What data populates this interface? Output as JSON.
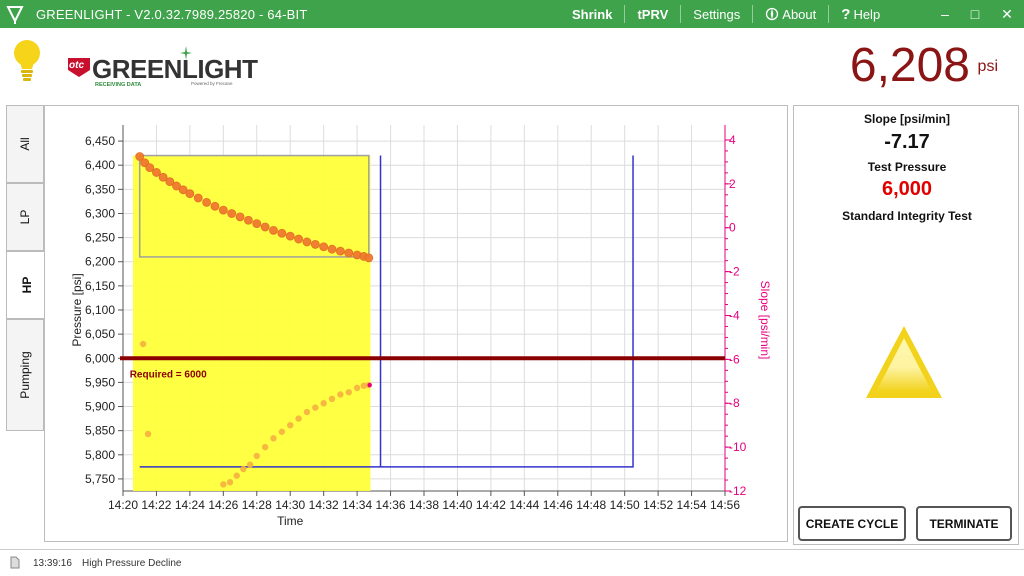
{
  "window": {
    "title": "GREENLIGHT - V2.0.32.7989.25820 - 64-BIT",
    "menu": {
      "shrink": "Shrink",
      "tprv": "tPRV",
      "settings": "Settings",
      "about": "About",
      "help": "Help"
    },
    "controls": {
      "minimize": "–",
      "maximize": "□",
      "close": "✕"
    }
  },
  "colors": {
    "titlebar": "#3ea34a",
    "pressure_red": "#8b1414",
    "required_line": "#8b0000",
    "highlight_fill": "#ffff33",
    "pressure_points": "#f07a2e",
    "slope_points": "#f5b041",
    "slope_axis": "#e6007e",
    "step_line": "#3333cc",
    "test_pressure": "#e00000",
    "triangle": "#f2d21a"
  },
  "brand": {
    "mark": "otc",
    "name": "GREENLIGHT",
    "status": "RECEIVING DATA",
    "powered": "Powered by Frecane",
    "bulb_icon": "lightbulb-icon"
  },
  "current_pressure": {
    "value": "6,208",
    "unit": "psi"
  },
  "tabs": [
    {
      "label": "All",
      "active": false
    },
    {
      "label": "LP",
      "active": false
    },
    {
      "label": "HP",
      "active": true
    },
    {
      "label": "Pumping",
      "active": false
    }
  ],
  "right_panel": {
    "slope_label": "Slope [psi/min]",
    "slope_value": "-7.17",
    "test_pressure_label": "Test Pressure",
    "test_pressure_value": "6,000",
    "test_name": "Standard Integrity Test",
    "status_icon": "warning-triangle-icon",
    "create_cycle_label": "CREATE CYCLE",
    "terminate_label": "TERMINATE"
  },
  "status_bar": {
    "icon": "document-icon",
    "time": "13:39:16",
    "message": "High Pressure Decline"
  },
  "chart_data": {
    "type": "scatter",
    "xlabel": "Time",
    "ylabel": "Pressure [psi]",
    "y2label": "Slope [psi/min]",
    "x_ticks": [
      "14:20",
      "14:22",
      "14:24",
      "14:26",
      "14:28",
      "14:30",
      "14:32",
      "14:34",
      "14:36",
      "14:38",
      "14:40",
      "14:42",
      "14:44",
      "14:46",
      "14:48",
      "14:50",
      "14:52",
      "14:54",
      "14:56"
    ],
    "x_range_minutes": [
      0,
      36
    ],
    "y_ticks": [
      "6,450",
      "6,400",
      "6,350",
      "6,300",
      "6,250",
      "6,200",
      "6,150",
      "6,100",
      "6,050",
      "6,000",
      "5,950",
      "5,900",
      "5,850",
      "5,800",
      "5,750"
    ],
    "ylim": [
      5725,
      6475
    ],
    "y2_ticks": [
      "4",
      "2",
      "0",
      "-2",
      "-4",
      "-6",
      "-8",
      "-10",
      "-12"
    ],
    "y2lim": [
      -12,
      4.5
    ],
    "grid": true,
    "required_line": {
      "value": 6000,
      "label": "Required = 6000"
    },
    "highlight_band": {
      "x_start": 0.6,
      "x_end": 14.8
    },
    "hold_box": {
      "x_start": 1.0,
      "x_end": 14.7,
      "y_low": 6210,
      "y_high": 6420
    },
    "step_trace": {
      "x_low": 1.0,
      "x_up1": 15.4,
      "x_up2": 30.5,
      "y_low": 5775,
      "y_high": 6420
    },
    "series": [
      {
        "name": "Pressure",
        "axis": "left",
        "x": [
          1.0,
          1.3,
          1.6,
          2.0,
          2.4,
          2.8,
          3.2,
          3.6,
          4.0,
          4.5,
          5.0,
          5.5,
          6.0,
          6.5,
          7.0,
          7.5,
          8.0,
          8.5,
          9.0,
          9.5,
          10.0,
          10.5,
          11.0,
          11.5,
          12.0,
          12.5,
          13.0,
          13.5,
          14.0,
          14.4,
          14.7
        ],
        "values": [
          6418,
          6405,
          6395,
          6385,
          6375,
          6366,
          6357,
          6349,
          6341,
          6332,
          6323,
          6315,
          6307,
          6300,
          6293,
          6286,
          6279,
          6272,
          6265,
          6259,
          6253,
          6247,
          6241,
          6236,
          6231,
          6226,
          6222,
          6218,
          6214,
          6211,
          6208
        ]
      },
      {
        "name": "Slope",
        "axis": "right",
        "x": [
          1.2,
          1.5,
          6.0,
          6.4,
          6.8,
          7.2,
          7.6,
          8.0,
          8.5,
          9.0,
          9.5,
          10.0,
          10.5,
          11.0,
          11.5,
          12.0,
          12.5,
          13.0,
          13.5,
          14.0,
          14.4,
          14.7
        ],
        "values": [
          -5.3,
          -9.4,
          -11.7,
          -11.6,
          -11.3,
          -11.0,
          -10.8,
          -10.4,
          -10.0,
          -9.6,
          -9.3,
          -9.0,
          -8.7,
          -8.4,
          -8.2,
          -8.0,
          -7.8,
          -7.6,
          -7.5,
          -7.3,
          -7.2,
          -7.17
        ]
      }
    ]
  }
}
